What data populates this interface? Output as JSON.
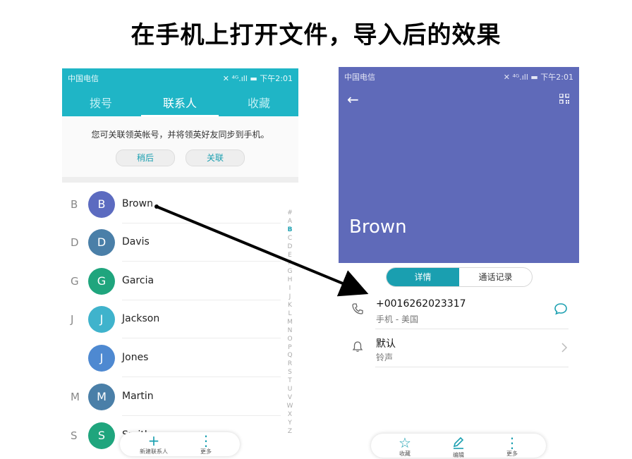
{
  "slide": {
    "title": "在手机上打开文件，导入后的效果"
  },
  "left": {
    "status": {
      "carrier": "中国电信",
      "icons": "✕ ⁴ᴳ.ıll ▬ 下午2:01"
    },
    "tabs": [
      "拨号",
      "联系人",
      "收藏"
    ],
    "notice": {
      "text": "您可关联领英帐号，并将领英好友同步到手机。",
      "later": "稍后",
      "link": "关联"
    },
    "contacts": [
      {
        "letter": "B",
        "initial": "B",
        "name": "Brown",
        "color": "#5c6bc0"
      },
      {
        "letter": "D",
        "initial": "D",
        "name": "Davis",
        "color": "#4a7fa8"
      },
      {
        "letter": "G",
        "initial": "G",
        "name": "Garcia",
        "color": "#1fa57d"
      },
      {
        "letter": "J",
        "initial": "J",
        "name": "Jackson",
        "color": "#3fb3cc"
      },
      {
        "letter": "",
        "initial": "J",
        "name": "Jones",
        "color": "#4e89d1"
      },
      {
        "letter": "M",
        "initial": "M",
        "name": "Martin",
        "color": "#4a7fa8"
      },
      {
        "letter": "S",
        "initial": "S",
        "name": "Smith",
        "color": "#1fa57d"
      }
    ],
    "index": [
      "#",
      "A",
      "B",
      "C",
      "D",
      "E",
      "F",
      "G",
      "H",
      "I",
      "J",
      "K",
      "L",
      "M",
      "N",
      "O",
      "P",
      "Q",
      "R",
      "S",
      "T",
      "U",
      "V",
      "W",
      "X",
      "Y",
      "Z"
    ],
    "index_active": "B",
    "bottom": {
      "new_icon": "+",
      "new": "新建联系人",
      "more_icon": "⋮",
      "more": "更多"
    }
  },
  "right": {
    "status": {
      "carrier": "中国电信",
      "icons": "✕ ⁴ᴳ.ıll ▬ 下午2:01"
    },
    "back_icon": "←",
    "name": "Brown",
    "tabs": [
      "详情",
      "通话记录"
    ],
    "phone": {
      "number": "+0016262023317",
      "label": "手机 - 美国"
    },
    "ringtone": {
      "value": "默认",
      "label": "铃声"
    },
    "bottom": {
      "fav_icon": "☆",
      "fav": "收藏",
      "edit": "编辑",
      "more_icon": "⋮",
      "more": "更多"
    }
  },
  "colors": {
    "teal": "#1fb5c6",
    "accent": "#1a9fb0",
    "header": "#5f6ab9"
  }
}
